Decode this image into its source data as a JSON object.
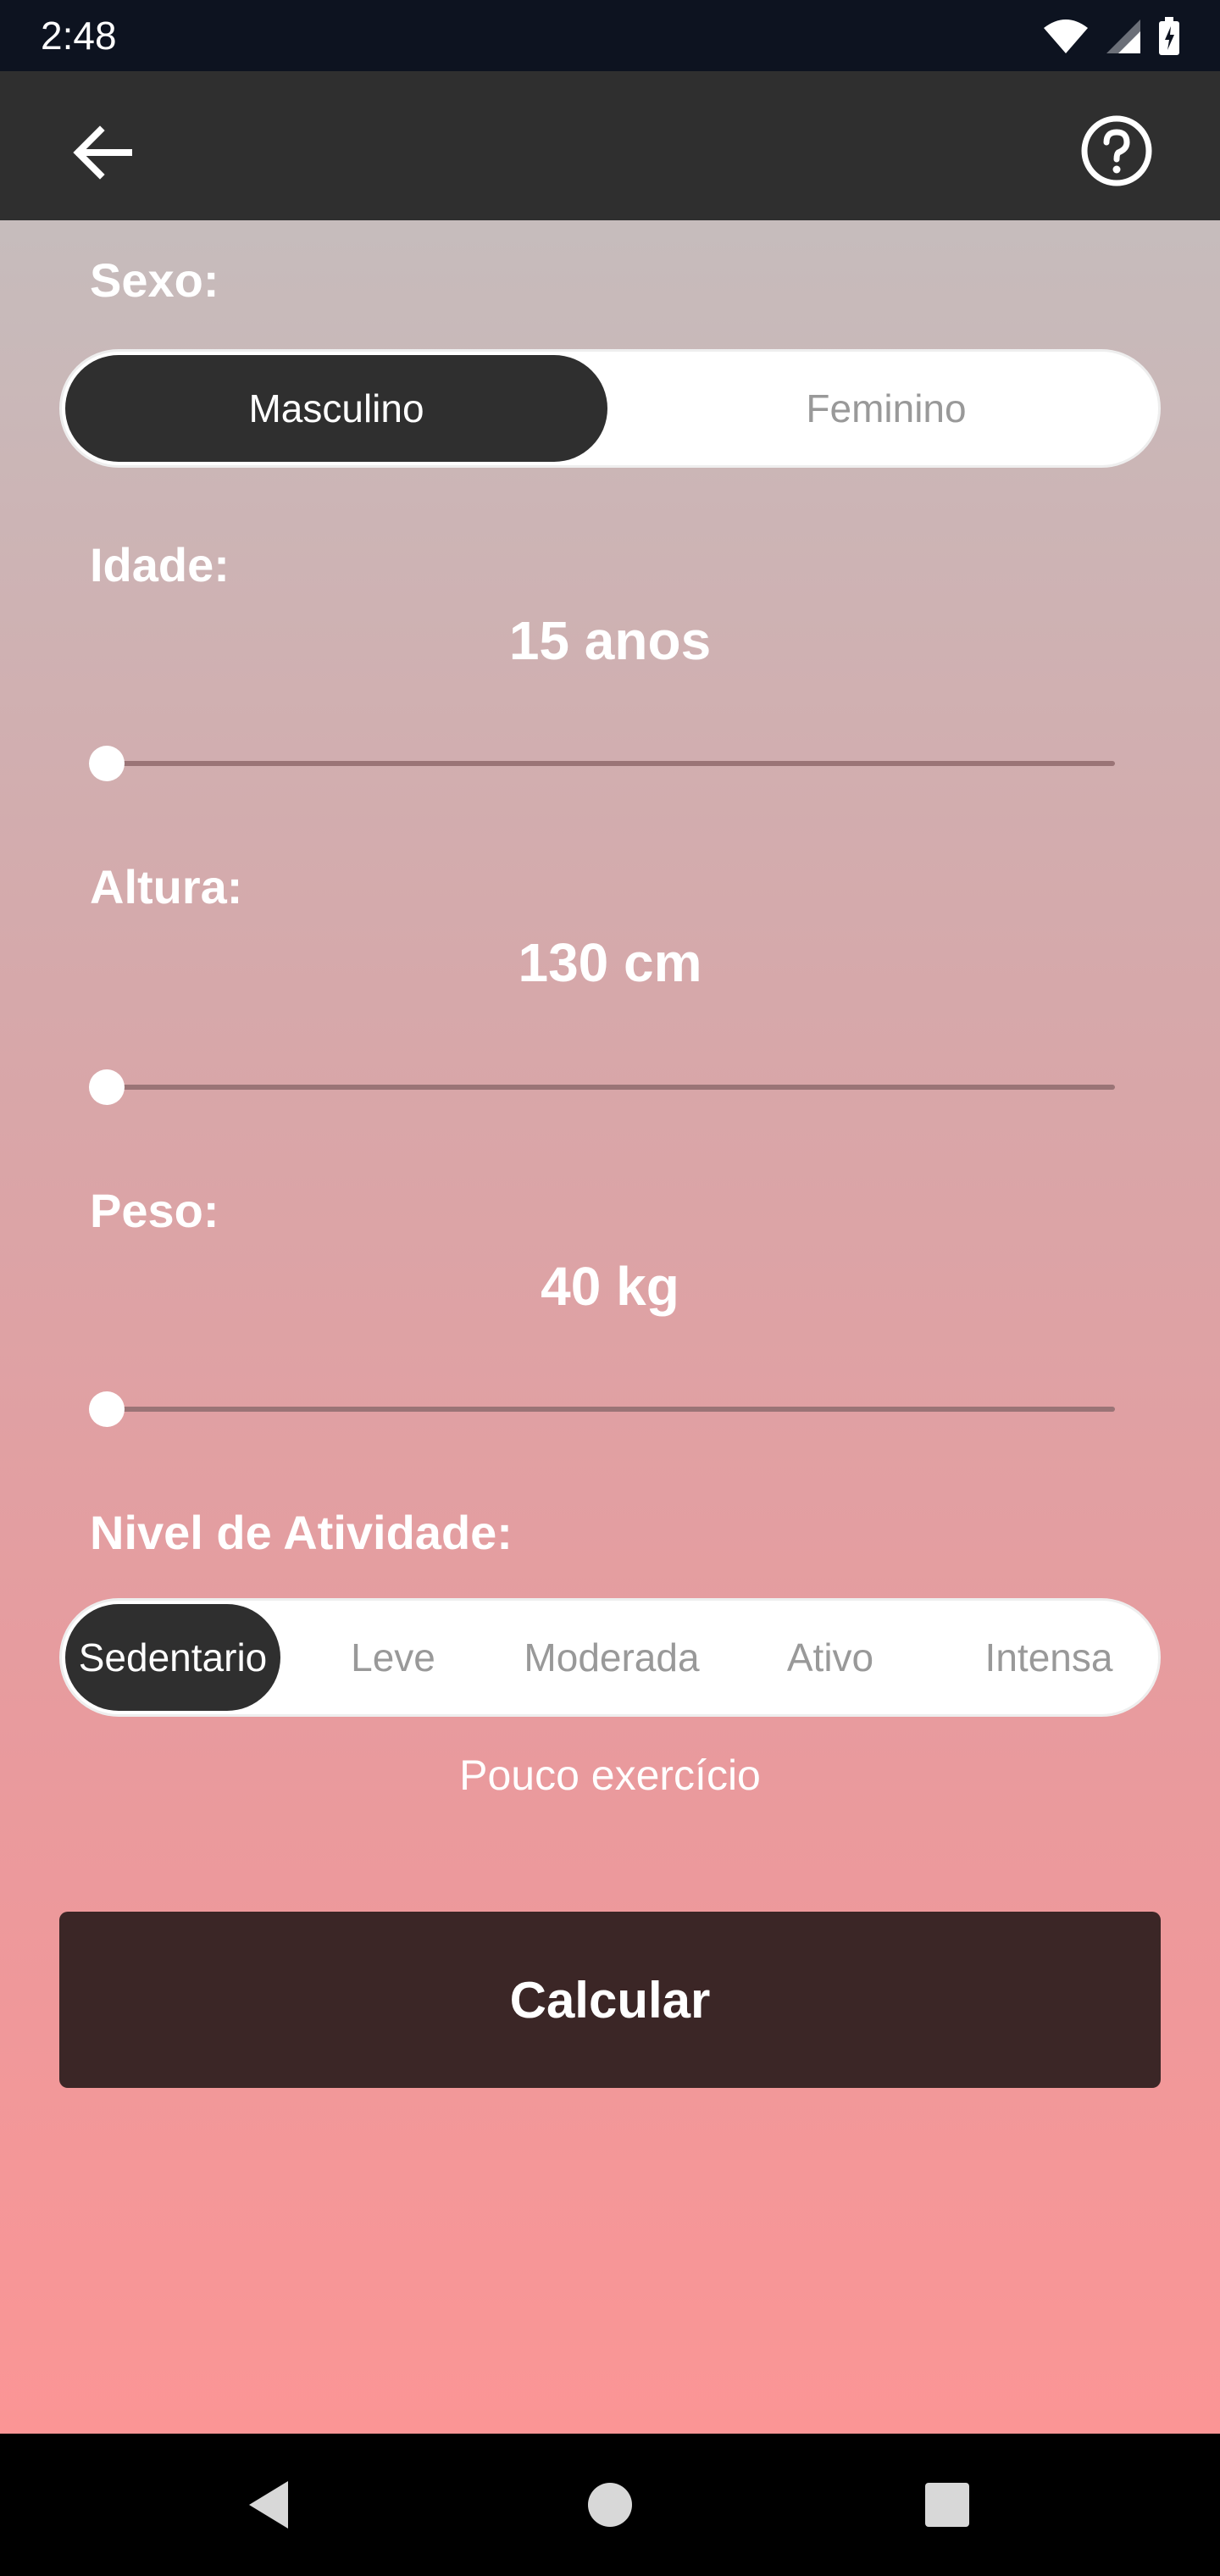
{
  "status_bar": {
    "time": "2:48",
    "icons": [
      "wifi-icon",
      "signal-icon",
      "battery-icon"
    ]
  },
  "app_bar": {
    "back_icon": "arrow-back-icon",
    "help_icon": "help-circle-icon"
  },
  "form": {
    "sex": {
      "label": "Sexo:",
      "options": [
        "Masculino",
        "Feminino"
      ],
      "selected": "Masculino"
    },
    "age": {
      "label": "Idade:",
      "value": "15 anos",
      "slider_fraction": 0.0
    },
    "height": {
      "label": "Altura:",
      "value": "130 cm",
      "slider_fraction": 0.0
    },
    "weight": {
      "label": "Peso:",
      "value": "40 kg",
      "slider_fraction": 0.0
    },
    "activity": {
      "label": "Nivel de Atividade:",
      "options": [
        "Sedentario",
        "Leve",
        "Moderada",
        "Ativo",
        "Intensa"
      ],
      "selected": "Sedentario",
      "description": "Pouco exercício"
    },
    "submit_label": "Calcular"
  },
  "colors": {
    "status_bar": "#0d1320",
    "app_bar": "#2f2f2f",
    "selected_pill": "#2f2f2f",
    "button": "#3b2626",
    "gradient_top": "#c6bcbc",
    "gradient_bottom": "#fb9595"
  },
  "nav_bar": {
    "icons": [
      "back-triangle-icon",
      "home-circle-icon",
      "recents-square-icon"
    ]
  }
}
